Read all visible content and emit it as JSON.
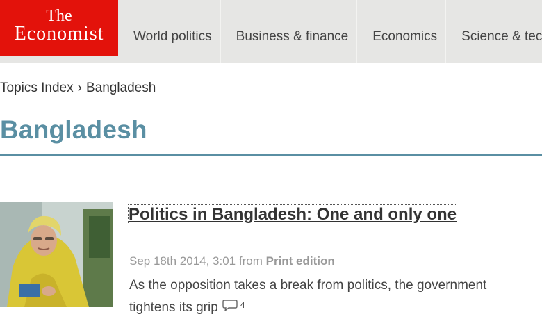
{
  "logo": {
    "line1": "The",
    "line2": "Economist"
  },
  "nav": [
    {
      "label": "World politics"
    },
    {
      "label": "Business & finance"
    },
    {
      "label": "Economics"
    },
    {
      "label": "Science & tec"
    }
  ],
  "breadcrumb": {
    "root": "Topics Index",
    "separator": "›",
    "current": "Bangladesh"
  },
  "page_title": "Bangladesh",
  "article": {
    "headline": "Politics in Bangladesh: One and only one",
    "date": "Sep 18th 2014, 3:01",
    "from": "from",
    "edition": "Print edition",
    "teaser": "As the opposition takes a break from politics, the government tightens its grip",
    "comment_count": "4"
  },
  "colors": {
    "brand_red": "#e3120b",
    "title_blue": "#5a8fa3",
    "nav_bg": "#e6e6e4"
  }
}
